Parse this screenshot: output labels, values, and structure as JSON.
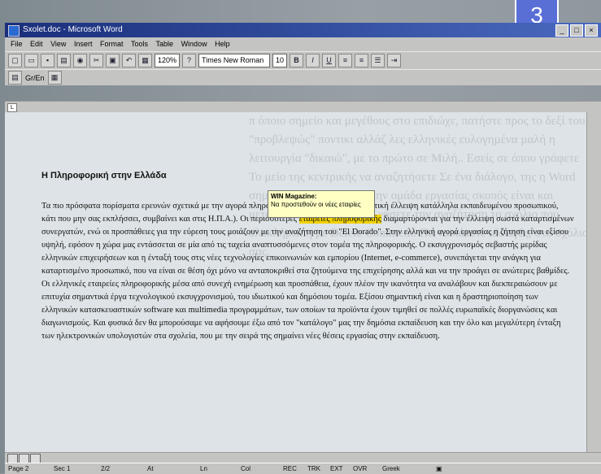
{
  "badge": "3",
  "window": {
    "title": "Sxolet.doc - Microsoft Word"
  },
  "menu": [
    "File",
    "Edit",
    "View",
    "Insert",
    "Format",
    "Tools",
    "Table",
    "Window",
    "Help"
  ],
  "toolbar": {
    "zoom": "120%",
    "font": "Times New Roman",
    "size": "10",
    "lang": "Gr/En"
  },
  "ghost_text": "π όποιο σημείο και μεγέθους στο επιδιώχε, πατήστε προς το δεξί του. \"προβλεψώς\" ποντικι αλλάζ λες ελληνικές ευλογημένα μαλή η λειτουργία \"δικαιώ\", με το πρώτο σε Μιλή.. Εσείς σε όπου γράφετε Το μείο της κεντρικής να αναζητήσετε Σε ένα διάλογο, της η Word σημειώσεις Ταλονιστικό την ομάδα εργασίας σκοπός είναι και μετάφραση Μας χωρίς να χάσετε την αναζήτηση το σχόλιο που ολοκλήρωση με Delete Comment. Πα να κάνετε αλλαγές, στο σχόλιο σας.",
  "document": {
    "heading": "Η Πληροφορική στην Ελλάδα",
    "para_a": "Τα πιο πρόσφατα πορίσματα ερευνών σχετικά με την αγορά πληροφορικής, αποδεικνύουν σημαντική έλλειψη κατάλληλα εκπαιδευμένου προσωπικού, κάτι που μην σας εκπλήσσει, συμβαίνει και στις Η.Π.Α.). Οι περισσότερες ",
    "highlight": "εταιρείες πληροφορικής",
    "para_b": " διαμαρτύρονται για την έλλειψη σωστά καταρτισμένων συνεργατών, ενώ οι προσπάθειες για την εύρεση τους μοιάζουν με την αναζήτηση του \"El Dorado\". Στην ελληνική αγορά εργασίας η ζήτηση είναι εξίσου υψηλή, εφόσον η χώρα μας εντάσσεται σε μία από τις ταχεία αναπτυσσόμενες στον τομέα της πληροφορικής. Ο εκσυγχρονισμός σεβαστής μερίδας ελληνικών επιχειρήσεων και η ένταξή τους στις νέες τεχνολογίες επικοινωνιών και εμπορίου (Internet, e-commerce), συνεπάγεται την ανάγκη για καταρτισμένο προσωπικό, που να είναι σε θέση όχι μόνο να ανταποκριθεί στα ζητούμενα της επιχείρησης αλλά και να την προάγει σε ανώτερες βαθμίδες. Οι ελληνικές εταιρείες πληροφορικής μέσα από συνεχή ενημέρωση και προσπάθεια, έχουν πλέον την ικανότητα να αναλάβουν και διεκπεραιώσουν με επιτυχία σημαντικά έργα τεχνολογικού εκσυγχρονισμού, του ιδιωτικού και δημόσιου τομέα. Εξίσου σημαντική είναι και η δραστηριοποίηση των ελληνικών κατασκευαστικών software και multimedia προγραμμάτων, των οποίων τα προϊόντα έχουν τιμηθεί σε πολλές ευρωπαϊκές διοργανώσεις και διαγωνισμούς. Και φυσικά δεν θα μπορούσαμε να αφήσουμε έξω από τον \"κατάλογο\" μας την δημόσια εκπαίδευση και την όλο και μεγαλύτερη ένταξη των ηλεκτρονικών υπολογιστών στα σχολεία, που με την σειρά της σημαίνει νέες θέσεις εργασίας στην εκπαίδευση."
  },
  "tooltip": {
    "title": "WIN Magazine:",
    "text": "Να προστεθούν οι νέες εταιρίες"
  },
  "status": {
    "page": "Page 2",
    "sec": "Sec 1",
    "count": "2/2",
    "at": "At",
    "ln": "Ln",
    "col": "Col",
    "rec": "REC",
    "trk": "TRK",
    "ext": "EXT",
    "ovr": "OVR",
    "lang": "Greek"
  }
}
